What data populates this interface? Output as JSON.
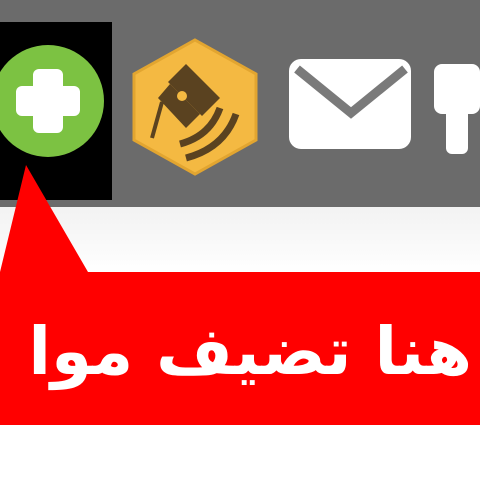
{
  "toolbar": {
    "buttons": [
      {
        "icon": "plus-circle-icon",
        "color": "#7cc242"
      },
      {
        "icon": "pen-nib-hexagon-icon",
        "color": "#f4b942"
      },
      {
        "icon": "envelope-icon",
        "color": "#ffffff"
      },
      {
        "icon": "partial-toolbar-icon",
        "color": "#ffffff"
      }
    ]
  },
  "callout": {
    "text": "هنا تضيف موا",
    "background": "#ff0000",
    "text_color": "#ffffff"
  }
}
